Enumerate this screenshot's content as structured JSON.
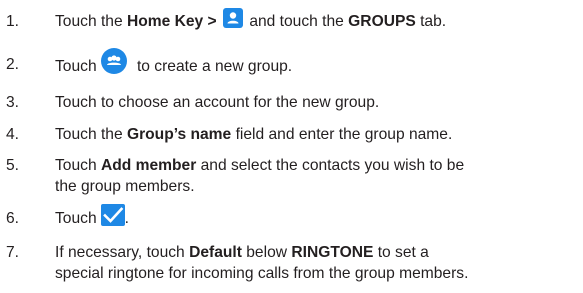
{
  "accent_color": "#1e88e5",
  "steps": [
    {
      "num": "1.",
      "a": "Touch the ",
      "b1": "Home Key >",
      "c": " and touch the ",
      "b2": "GROUPS",
      "d": " tab."
    },
    {
      "num": "2.",
      "a": "Touch",
      "c": " to create a new group."
    },
    {
      "num": "3.",
      "a": "Touch to choose an account for the new group."
    },
    {
      "num": "4.",
      "a": "Touch the ",
      "b1": "Group’s name",
      "c": " field and enter the group name."
    },
    {
      "num": "5.",
      "a": "Touch ",
      "b1": "Add member",
      "c": " and select the contacts you wish to be",
      "line2": "the group members."
    },
    {
      "num": "6.",
      "a": "Touch",
      "c": "."
    },
    {
      "num": "7.",
      "a": "If necessary, touch ",
      "b1": "Default",
      "c": " below ",
      "b2": "RINGTONE",
      "d": " to set a",
      "line2": "special ringtone for incoming calls from the group members."
    }
  ],
  "icons": {
    "step1": "contacts-app-icon",
    "step2": "add-group-fab-icon",
    "step6": "checkmark-save-icon"
  }
}
